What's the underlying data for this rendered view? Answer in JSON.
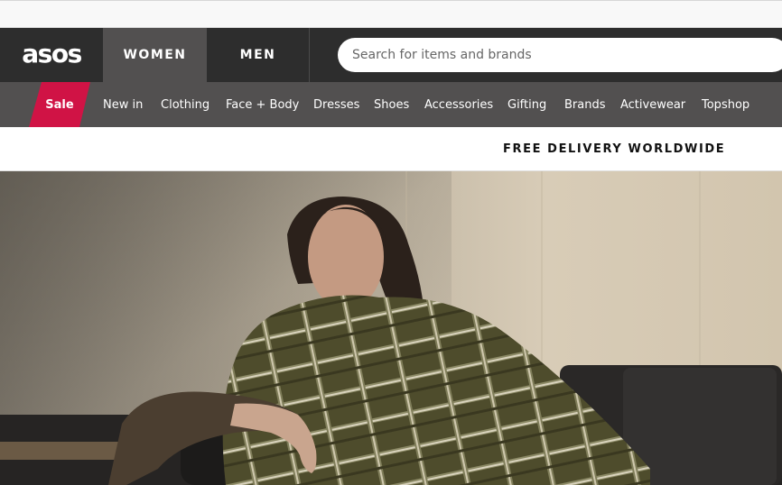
{
  "header": {
    "logo": "asos",
    "tabs": [
      {
        "label": "WOMEN",
        "active": true
      },
      {
        "label": "MEN",
        "active": false
      }
    ]
  },
  "search": {
    "placeholder": "Search for items and brands",
    "value": ""
  },
  "nav": {
    "sale_label": "Sale",
    "items": [
      "New in",
      "Clothing",
      "Face + Body",
      "Dresses",
      "Shoes",
      "Accessories",
      "Gifting",
      "Brands",
      "Activewear",
      "Topshop"
    ]
  },
  "promo": {
    "text": "FREE DELIVERY WORLDWIDE"
  },
  "colors": {
    "header_bg": "#2d2d2d",
    "active_tab_bg": "#525050",
    "nav_bg": "#525050",
    "sale_accent": "#d01345"
  }
}
